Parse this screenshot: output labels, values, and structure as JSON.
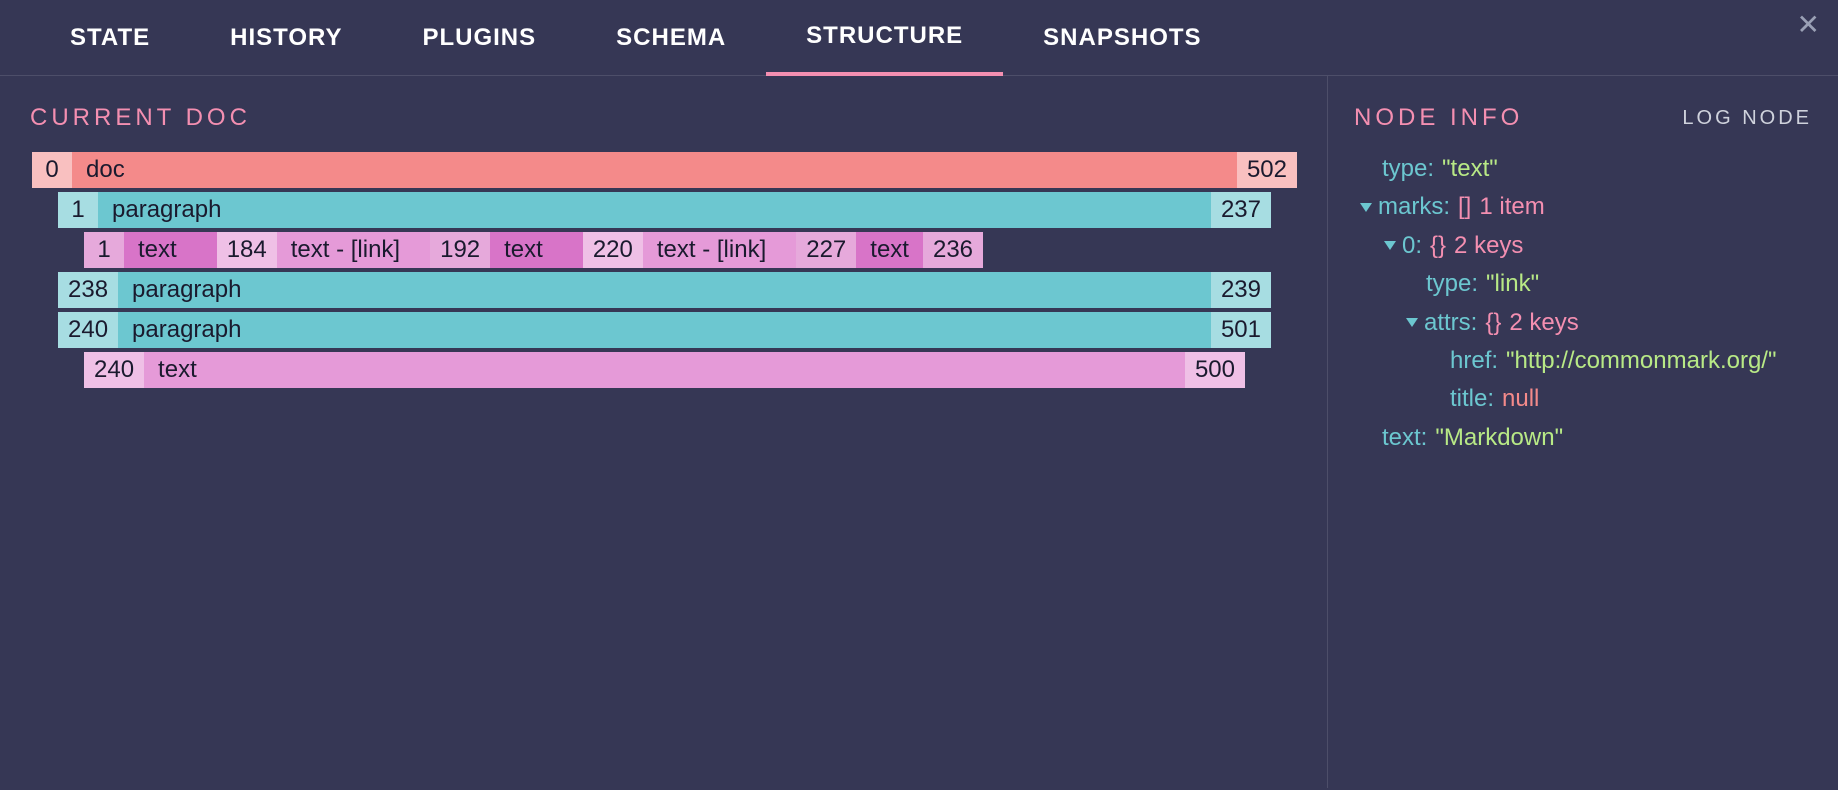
{
  "tabs": {
    "state": "STATE",
    "history": "HISTORY",
    "plugins": "PLUGINS",
    "schema": "SCHEMA",
    "structure": "STRUCTURE",
    "snapshots": "SNAPSHOTS"
  },
  "close_glyph": "✕",
  "left": {
    "title": "CURRENT DOC",
    "doc": {
      "start": "0",
      "label": "doc",
      "end": "502"
    },
    "para1": {
      "start": "1",
      "label": "paragraph",
      "end": "237"
    },
    "seg1": {
      "start": "1",
      "label": "text"
    },
    "seg2": {
      "start": "184",
      "label": "text  -  [link]"
    },
    "seg3": {
      "start": "192",
      "label": "text"
    },
    "seg4": {
      "start": "220",
      "label": "text  -  [link]"
    },
    "seg5": {
      "start": "227",
      "label": "text"
    },
    "seg_end": "236",
    "para2": {
      "start": "238",
      "label": "paragraph",
      "end": "239"
    },
    "para3": {
      "start": "240",
      "label": "paragraph",
      "end": "501"
    },
    "text3": {
      "start": "240",
      "label": "text",
      "end": "500"
    }
  },
  "right": {
    "title": "NODE INFO",
    "log": "LOG NODE",
    "type_key": "type:",
    "type_val": "\"text\"",
    "marks_key": "marks:",
    "marks_sym": "[]",
    "marks_meta": "1 item",
    "idx_key": "0:",
    "idx_sym": "{}",
    "idx_meta": "2 keys",
    "inner_type_key": "type:",
    "inner_type_val": "\"link\"",
    "attrs_key": "attrs:",
    "attrs_sym": "{}",
    "attrs_meta": "2 keys",
    "href_key": "href:",
    "href_val": "\"http://commonmark.org/\"",
    "title_key": "title:",
    "title_val": "null",
    "text_key": "text:",
    "text_val": "\"Markdown\""
  }
}
